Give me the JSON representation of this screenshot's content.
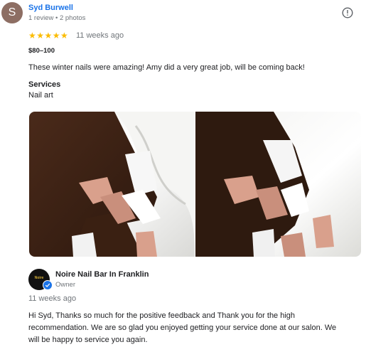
{
  "reviewer": {
    "initial": "S",
    "name": "Syd Burwell",
    "meta": "1 review • 2 photos"
  },
  "rating": {
    "stars": "★★★★★",
    "value": 5,
    "max": 5,
    "time": "11 weeks ago"
  },
  "price": "$80–100",
  "review_text": "These winter nails were amazing! Amy did a very great job, will be coming back!",
  "services": {
    "heading": "Services",
    "value": "Nail art"
  },
  "photos": [
    {
      "subject": "winter-nails-photo"
    },
    {
      "subject": "winter-nails-photo"
    }
  ],
  "owner_reply": {
    "logo_text": "Noire",
    "name": "Noire Nail Bar In Franklin",
    "role": "Owner",
    "time": "11 weeks ago",
    "lines": [
      "Hi Syd, Thanks so much for the positive feedback and Thank you for the high",
      "recommendation. We are so glad you enjoyed getting your service done at our salon. We",
      "will be happy to service you again."
    ]
  },
  "icons": {
    "report": "report-icon",
    "verified": "verified-check-icon"
  },
  "colors": {
    "accent": "#1a73e8",
    "star": "#fbbc04",
    "secondary_text": "#70757a"
  }
}
